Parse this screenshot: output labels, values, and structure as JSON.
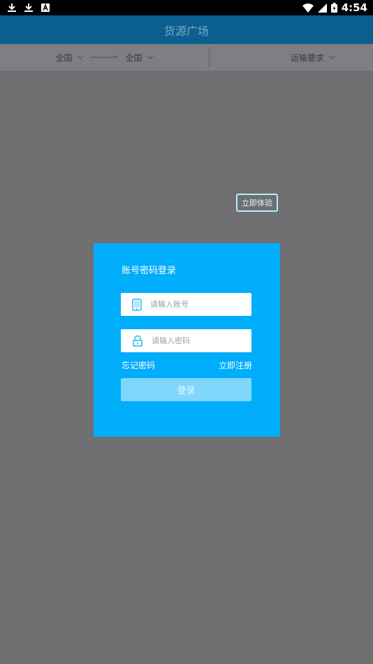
{
  "status_bar": {
    "time": "4:54"
  },
  "header": {
    "title": "货源广场"
  },
  "filters": {
    "origin": "全国",
    "destination": "全国",
    "requirement": "运输要求"
  },
  "try_button": {
    "label": "立即体验"
  },
  "login": {
    "title": "账号密码登录",
    "username_placeholder": "请输入账号",
    "password_placeholder": "请输入密码",
    "forgot": "忘记密码",
    "register": "立即注册",
    "submit": "登录"
  }
}
